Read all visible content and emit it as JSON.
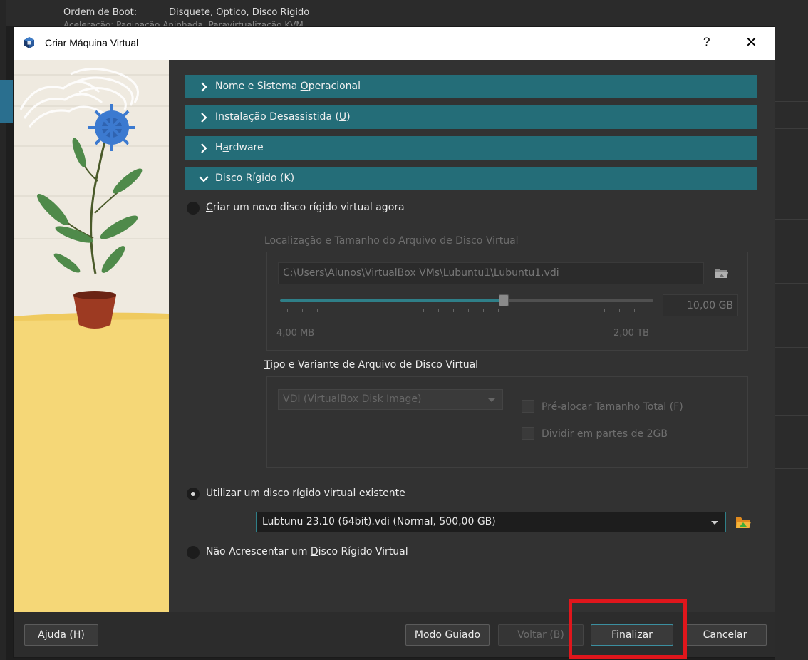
{
  "background": {
    "boot_order_label": "Ordem de Boot:",
    "boot_order_value": "Disquete, Optico, Disco Rigido",
    "hidden_row_text": "Aceleração: Paginação Aninhada, Paravirtualização KVM"
  },
  "dialog": {
    "title": "Criar Máquina Virtual",
    "help_glyph": "?",
    "close_glyph": "✕"
  },
  "sections": [
    {
      "pre": "Nome e Sistema ",
      "u": "O",
      "post": "peracional",
      "expanded": false
    },
    {
      "pre": "Instalação Desassistida (",
      "u": "U",
      "post": ")",
      "expanded": false
    },
    {
      "pre": "H",
      "u": "a",
      "post": "rdware",
      "expanded": false
    },
    {
      "pre": "Disco Rígido (",
      "u": "K",
      "post": ")",
      "expanded": true
    }
  ],
  "disk": {
    "option_new": {
      "pre": "",
      "u": "C",
      "post": "riar um novo disco rígido virtual agora",
      "selected": false
    },
    "location_group_title": "Localização e Tamanho do Arquivo de Disco Virtual",
    "path_value": "C:\\Users\\Alunos\\VirtualBox VMs\\Lubuntu1\\Lubuntu1.vdi",
    "size_value": "10,00 GB",
    "size_min_label": "4,00 MB",
    "size_max_label": "2,00 TB",
    "slider_fraction": 0.6,
    "type_group_title": {
      "pre": "",
      "u": "T",
      "post": "ipo e Variante de Arquivo de Disco Virtual"
    },
    "type_select_value": "VDI (VirtualBox Disk Image)",
    "preallocate": {
      "pre": "Pré-alocar Tamanho Total (",
      "u": "F",
      "post": ")",
      "checked": false
    },
    "split": {
      "pre": "Dividir em partes ",
      "u": "d",
      "post": "e 2GB",
      "checked": false
    },
    "option_existing": {
      "pre": "Utilizar um di",
      "u": "s",
      "post": "co rígido virtual existente",
      "selected": true
    },
    "existing_select_value": "Lubtunu 23.10 (64bit).vdi (Normal, 500,00 GB)",
    "option_none": {
      "pre": "Não Acrescentar um ",
      "u": "D",
      "post": "isco Rígido Virtual",
      "selected": false
    }
  },
  "footer": {
    "help": {
      "pre": "Ajuda (",
      "u": "H",
      "post": ")"
    },
    "guided": {
      "pre": "Modo ",
      "u": "G",
      "post": "uiado"
    },
    "back": {
      "pre": "Voltar (",
      "u": "B",
      "post": ")",
      "enabled": false
    },
    "finish": {
      "pre": "",
      "u": "F",
      "post": "inalizar"
    },
    "cancel": {
      "pre": "",
      "u": "C",
      "post": "ancelar"
    }
  },
  "colors": {
    "section_header": "#246d78",
    "accent": "#2f7f88",
    "highlight_box": "#e0161c",
    "dialog_bg": "#323232"
  },
  "icons": [
    "virtualbox-icon",
    "chevron-right-icon",
    "chevron-down-icon",
    "folder-icon",
    "folder-open-green-icon"
  ]
}
